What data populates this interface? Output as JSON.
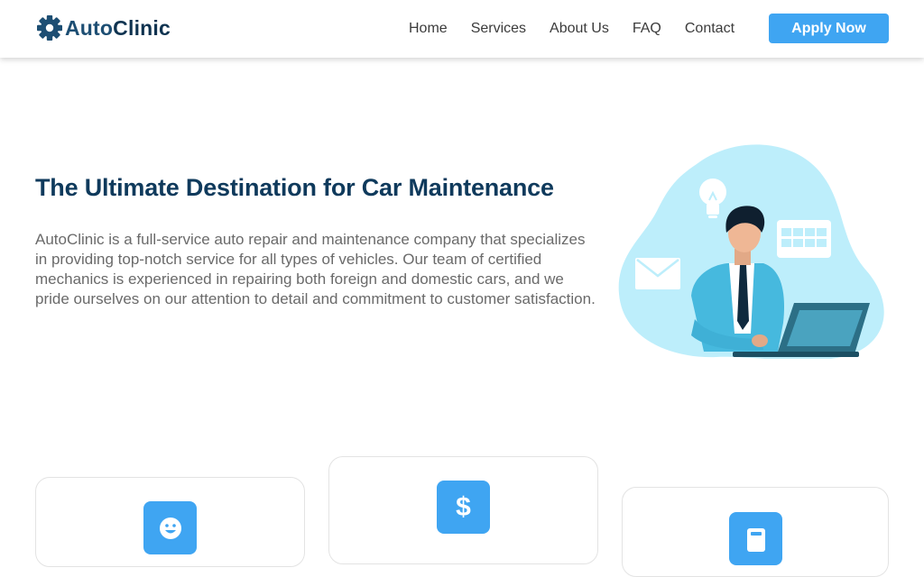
{
  "header": {
    "logo": {
      "part1": "Auto",
      "part2": "Clinic",
      "icon": "gear-icon"
    },
    "nav": [
      {
        "label": "Home"
      },
      {
        "label": "Services"
      },
      {
        "label": "About Us"
      },
      {
        "label": "FAQ"
      },
      {
        "label": "Contact"
      }
    ],
    "cta_label": "Apply Now"
  },
  "hero": {
    "title": "The Ultimate Destination for Car Maintenance",
    "description": "AutoClinic is a full-service auto repair and maintenance company that specializes in providing top-notch service for all types of vehicles. Our team of certified mechanics is experienced in repairing both foreign and domestic cars, and we pride ourselves on our attention to detail and commitment to customer satisfaction.",
    "illustration": "businessman-laptop-illustration"
  },
  "features": [
    {
      "icon": "smiley-icon"
    },
    {
      "icon": "dollar-icon",
      "glyph": "$"
    },
    {
      "icon": "calculator-icon"
    }
  ],
  "colors": {
    "accent": "#3fa5f2",
    "title": "#0f3a5c",
    "logo_dark": "#1d4e73",
    "body_text": "#6a6a6a",
    "blob": "#bdeefb"
  }
}
